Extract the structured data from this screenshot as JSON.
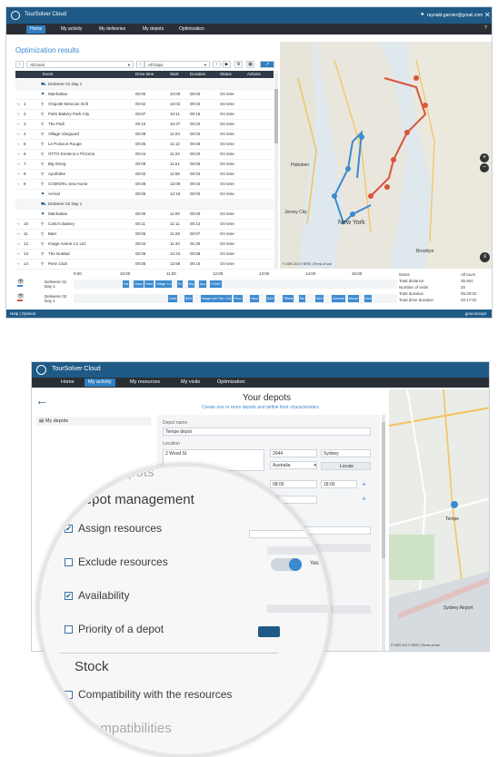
{
  "shot1": {
    "app_title": "TourSolver Cloud",
    "user": "raynald.garnier@gmail.com",
    "nav": [
      "Home",
      "My activity",
      "My deliveries",
      "My depots",
      "Optimization"
    ],
    "panel_title": "Optimization results",
    "tour_select": "All tours",
    "day_select": "All Days",
    "columns": [
      "Event",
      "Drive time",
      "Start",
      "Duration",
      "Status",
      "Actions"
    ],
    "rows": [
      {
        "idx": "",
        "event": "Deliverer 01 Day 1",
        "drive": "",
        "start": "",
        "dur": "",
        "status": "",
        "group": true
      },
      {
        "idx": "",
        "event": "Manhattan",
        "drive": "00:00",
        "start": "10:00",
        "dur": "00:00",
        "status": "On time"
      },
      {
        "idx": "1",
        "event": "Chipotle Mexican Grill",
        "drive": "00:02",
        "start": "10:02",
        "dur": "00:03",
        "status": "On time"
      },
      {
        "idx": "2",
        "event": "Palm Battery Park City",
        "drive": "00:07",
        "start": "10:11",
        "dur": "00:15",
        "status": "On time"
      },
      {
        "idx": "3",
        "event": "The Park",
        "drive": "00:10",
        "start": "10:37",
        "dur": "00:20",
        "status": "On time"
      },
      {
        "idx": "4",
        "event": "Village Vanguard",
        "drive": "00:08",
        "start": "11:04",
        "dur": "00:03",
        "status": "On time"
      },
      {
        "idx": "5",
        "event": "Le Poisson Rouge",
        "drive": "00:05",
        "start": "11:12",
        "dur": "00:06",
        "status": "On time"
      },
      {
        "idx": "6",
        "event": "OTTO Enoteca e Pizzeria",
        "drive": "00:04",
        "start": "11:22",
        "dur": "00:20",
        "status": "On time"
      },
      {
        "idx": "7",
        "event": "Big Wong",
        "drive": "00:09",
        "start": "11:51",
        "dur": "00:05",
        "status": "On time"
      },
      {
        "idx": "8",
        "event": "Apothéke",
        "drive": "00:02",
        "start": "11:58",
        "dur": "00:04",
        "status": "On time"
      },
      {
        "idx": "9",
        "event": "COMGRIL Sea Horse",
        "drive": "00:06",
        "start": "12:08",
        "dur": "00:04",
        "status": "On time"
      },
      {
        "idx": "",
        "event": "Arrival",
        "drive": "00:05",
        "start": "12:16",
        "dur": "00:00",
        "status": "On time"
      },
      {
        "idx": "",
        "event": "Deliverer 02 Day 1",
        "drive": "",
        "start": "",
        "dur": "",
        "status": "",
        "group": true
      },
      {
        "idx": "",
        "event": "Manhattan",
        "drive": "00:00",
        "start": "11:00",
        "dur": "00:00",
        "status": "On time"
      },
      {
        "idx": "10",
        "event": "Carlo's Bakery",
        "drive": "00:11",
        "start": "11:11",
        "dur": "00:12",
        "status": "On time"
      },
      {
        "idx": "11",
        "event": "B&H",
        "drive": "00:06",
        "start": "11:29",
        "dur": "00:07",
        "status": "On time"
      },
      {
        "idx": "12",
        "event": "Image Anime Co Ltd",
        "drive": "00:04",
        "start": "11:40",
        "dur": "01:30",
        "status": "On time"
      },
      {
        "idx": "13",
        "event": "The NoMad",
        "drive": "00:05",
        "start": "12:43",
        "dur": "00:08",
        "status": "On time"
      },
      {
        "idx": "14",
        "event": "Penn Club",
        "drive": "00:05",
        "start": "12:56",
        "dur": "00:10",
        "status": "On time"
      }
    ],
    "gantt": {
      "hours": [
        "9:00",
        "10:00",
        "11:00",
        "12:00",
        "13:00",
        "14:00",
        "15:00"
      ],
      "drivers": [
        "Deliverer 01 Day 1",
        "Deliverer 02 Day 1"
      ],
      "blocks1": [
        "Pat",
        "Chipo",
        "Palm",
        "Village",
        "Le",
        "Po",
        "Big",
        "Apo",
        "COMG"
      ],
      "blocks2": [
        "Carlo",
        "B&H",
        "Image Anime Co Ltd",
        "The",
        "Penn",
        "Hard",
        "B&H",
        "Tiffany",
        "Ris",
        "B&H",
        "Cinemat",
        "Macys",
        "Mini"
      ]
    },
    "stats": [
      {
        "label": "Name",
        "value": "All tours"
      },
      {
        "label": "Total distance",
        "value": "35.8mi"
      },
      {
        "label": "Number of visits",
        "value": "20"
      },
      {
        "label": "Total duration",
        "value": "05:28:02"
      },
      {
        "label": "Total drive duration",
        "value": "02:17:02"
      }
    ],
    "footer_left": "Help | Opinion",
    "footer_brand": "geoconcept",
    "map_labels": [
      "Hoboken",
      "New York",
      "Jersey City",
      "Brooklyn"
    ],
    "map_attrib": "© 1987-2017 HERE | Terms of use",
    "map_zoom_plus": "+",
    "map_zoom_minus": "−"
  },
  "shot2": {
    "app_title": "TourSolver Cloud",
    "nav": [
      "Home",
      "My activity",
      "My resources",
      "My visits",
      "Optimization"
    ],
    "page_title": "Your depots",
    "page_subtitle": "Create one or more depots and define their characteristics",
    "side_item": "My depots",
    "depot_name_label": "Depot name",
    "depot_name": "Tempe depot",
    "location_label": "Location",
    "address": "2 Wood St",
    "postcode": "2044",
    "city": "Sydney",
    "country": "Australia",
    "locate_btn": "Locate",
    "time_from": "08:00",
    "time_to": "18:00",
    "duration": "1:0",
    "toggle_label": "Yes",
    "map_labels": [
      "Tempe",
      "Sydney Airport"
    ],
    "map_attrib": "© 1987-2017 HERE | Terms of use"
  },
  "magnifier": {
    "top_partial": "Depots",
    "heading1": "Depot management",
    "items1": [
      {
        "label": "Assign resources",
        "checked": true
      },
      {
        "label": "Exclude resources",
        "checked": false
      },
      {
        "label": "Availability",
        "checked": true
      },
      {
        "label": "Priority of a depot",
        "checked": false
      }
    ],
    "heading2": "Stock",
    "items2": [
      {
        "label": "Compatibility with the resources",
        "checked": false
      }
    ],
    "bottom_partial": "Incompatibilities"
  },
  "colors": {
    "brand": "#1f5a86",
    "accent": "#2f7fc2",
    "route_red": "#d9553b",
    "route_blue": "#3b8ad0"
  }
}
